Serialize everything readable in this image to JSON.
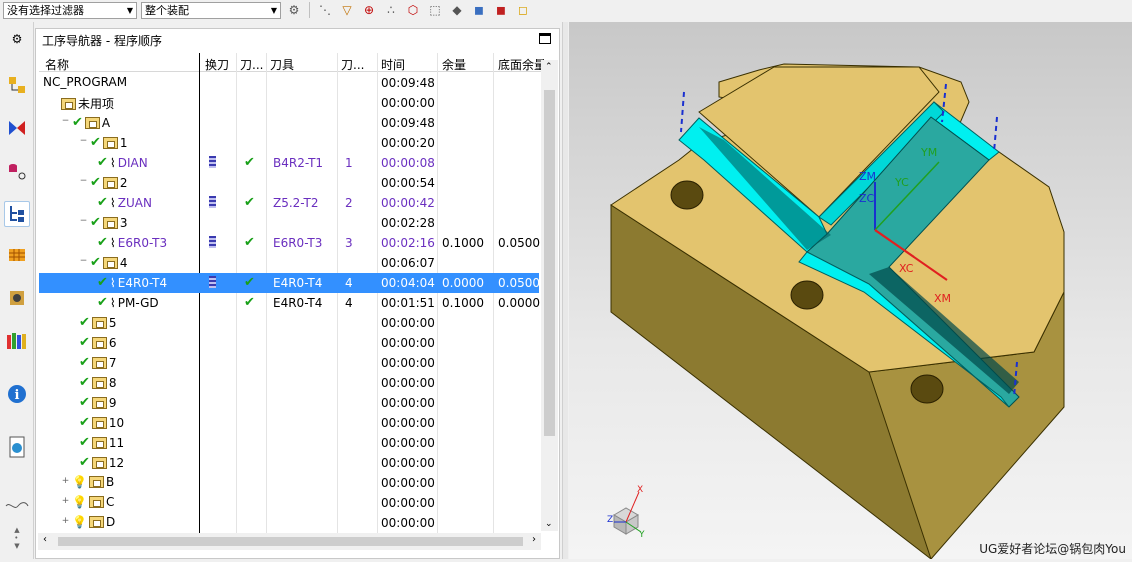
{
  "toolbar": {
    "filter_value": "没有选择过滤器",
    "assembly_value": "整个装配"
  },
  "navigator": {
    "title": "工序导航器 - 程序顺序",
    "columns": [
      "名称",
      "换刀",
      "刀...",
      "刀具",
      "刀...",
      "时间",
      "余量",
      "底面余量"
    ],
    "rows": [
      {
        "name": "NC_PROGRAM",
        "kind": "root",
        "tool": "",
        "num": "",
        "time": "00:09:48",
        "stock": "",
        "floor": ""
      },
      {
        "name": "未用项",
        "kind": "folder",
        "tool": "",
        "num": "",
        "time": "00:00:00",
        "stock": "",
        "floor": ""
      },
      {
        "name": "A",
        "kind": "folder",
        "tool": "",
        "num": "",
        "time": "00:09:48",
        "stock": "",
        "floor": ""
      },
      {
        "name": "1",
        "kind": "folder",
        "tool": "",
        "num": "",
        "time": "00:00:20",
        "stock": "",
        "floor": ""
      },
      {
        "name": "DIAN",
        "kind": "op",
        "tool": "B4R2-T1",
        "num": "1",
        "time": "00:00:08",
        "stock": "",
        "floor": ""
      },
      {
        "name": "2",
        "kind": "folder",
        "tool": "",
        "num": "",
        "time": "00:00:54",
        "stock": "",
        "floor": ""
      },
      {
        "name": "ZUAN",
        "kind": "op",
        "tool": "Z5.2-T2",
        "num": "2",
        "time": "00:00:42",
        "stock": "",
        "floor": ""
      },
      {
        "name": "3",
        "kind": "folder",
        "tool": "",
        "num": "",
        "time": "00:02:28",
        "stock": "",
        "floor": ""
      },
      {
        "name": "E6R0-T3",
        "kind": "op",
        "tool": "E6R0-T3",
        "num": "3",
        "time": "00:02:16",
        "stock": "0.1000",
        "floor": "0.0500"
      },
      {
        "name": "4",
        "kind": "folder",
        "tool": "",
        "num": "",
        "time": "00:06:07",
        "stock": "",
        "floor": ""
      },
      {
        "name": "E4R0-T4",
        "kind": "op-sel",
        "tool": "E4R0-T4",
        "num": "4",
        "time": "00:04:04",
        "stock": "0.0000",
        "floor": "0.0500"
      },
      {
        "name": "PM-GD",
        "kind": "op2",
        "tool": "E4R0-T4",
        "num": "4",
        "time": "00:01:51",
        "stock": "0.1000",
        "floor": "0.0000"
      },
      {
        "name": "5",
        "kind": "folder",
        "tool": "",
        "num": "",
        "time": "00:00:00",
        "stock": "",
        "floor": ""
      },
      {
        "name": "6",
        "kind": "folder",
        "tool": "",
        "num": "",
        "time": "00:00:00",
        "stock": "",
        "floor": ""
      },
      {
        "name": "7",
        "kind": "folder",
        "tool": "",
        "num": "",
        "time": "00:00:00",
        "stock": "",
        "floor": ""
      },
      {
        "name": "8",
        "kind": "folder",
        "tool": "",
        "num": "",
        "time": "00:00:00",
        "stock": "",
        "floor": ""
      },
      {
        "name": "9",
        "kind": "folder",
        "tool": "",
        "num": "",
        "time": "00:00:00",
        "stock": "",
        "floor": ""
      },
      {
        "name": "10",
        "kind": "folder",
        "tool": "",
        "num": "",
        "time": "00:00:00",
        "stock": "",
        "floor": ""
      },
      {
        "name": "11",
        "kind": "folder",
        "tool": "",
        "num": "",
        "time": "00:00:00",
        "stock": "",
        "floor": ""
      },
      {
        "name": "12",
        "kind": "folder",
        "tool": "",
        "num": "",
        "time": "00:00:00",
        "stock": "",
        "floor": ""
      },
      {
        "name": "B",
        "kind": "prog",
        "tool": "",
        "num": "",
        "time": "00:00:00",
        "stock": "",
        "floor": ""
      },
      {
        "name": "C",
        "kind": "prog",
        "tool": "",
        "num": "",
        "time": "00:00:00",
        "stock": "",
        "floor": ""
      },
      {
        "name": "D",
        "kind": "prog",
        "tool": "",
        "num": "",
        "time": "00:00:00",
        "stock": "",
        "floor": ""
      }
    ]
  },
  "viewport": {
    "axis_labels": {
      "zm": "ZM",
      "zc": "ZC",
      "ym": "YM",
      "yc": "YC",
      "xc": "XC",
      "xm": "XM"
    },
    "triad": {
      "x": "X",
      "y": "Y",
      "z": "Z"
    },
    "watermark": "UG爱好者论坛@锅包肉You"
  },
  "colors": {
    "part": "#e3c46e",
    "cut": "#00f0f0",
    "selection": "#3390ff",
    "check": "#18a018",
    "op_text": "#6a2fbf"
  }
}
